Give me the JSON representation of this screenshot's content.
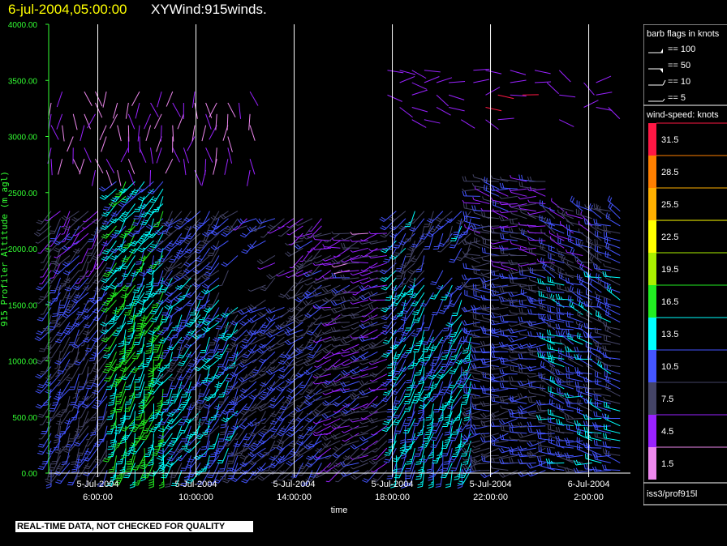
{
  "header": {
    "timestamp": "6-jul-2004,05:00:00",
    "variable": "XYWind:915winds."
  },
  "colors": {
    "title": "#ffff00",
    "y_axis": "#33ff33",
    "frame": "#ffffff"
  },
  "legend": {
    "barb_title": "barb flags in knots",
    "barbs": [
      {
        "label": "== 100"
      },
      {
        "label": "== 50"
      },
      {
        "label": "== 10"
      },
      {
        "label": "== 5"
      }
    ],
    "speed_title": "wind-speed: knots",
    "speed_bins": [
      {
        "label": "31.5",
        "color": "#ff1744"
      },
      {
        "label": "28.5",
        "color": "#ff7f00"
      },
      {
        "label": "25.5",
        "color": "#ffb000"
      },
      {
        "label": "22.5",
        "color": "#ffff00"
      },
      {
        "label": "19.5",
        "color": "#aaf000"
      },
      {
        "label": "16.5",
        "color": "#22ee22"
      },
      {
        "label": "13.5",
        "color": "#00ffff"
      },
      {
        "label": "10.5",
        "color": "#4455ff"
      },
      {
        "label": "7.5",
        "color": "#444466"
      },
      {
        "label": "4.5",
        "color": "#9922ff"
      },
      {
        "label": "1.5",
        "color": "#ee88ee"
      }
    ],
    "source": "iss3/prof915l"
  },
  "disclaimer": "REAL-TIME DATA, NOT CHECKED FOR QUALITY",
  "chart_data": {
    "type": "scatter",
    "subtype": "wind-barb time-height",
    "ylabel": "915 Profiler Altitude (m agl)",
    "xlabel": "time",
    "ylim": [
      0,
      4000
    ],
    "y_ticks": [
      "0.00",
      "500.00",
      "1000.00",
      "1500.00",
      "2000.00",
      "2500.00",
      "3000.00",
      "3500.00",
      "4000.00"
    ],
    "xlim_hours": [
      4.0,
      27.7
    ],
    "x_ticks": [
      {
        "hours": 6,
        "date": "5-Jul-2004",
        "time": "6:00:00"
      },
      {
        "hours": 10,
        "date": "5-Jul-2004",
        "time": "10:00:00"
      },
      {
        "hours": 14,
        "date": "5-Jul-2004",
        "time": "14:00:00"
      },
      {
        "hours": 18,
        "date": "5-Jul-2004",
        "time": "18:00:00"
      },
      {
        "hours": 22,
        "date": "5-Jul-2004",
        "time": "22:00:00"
      },
      {
        "hours": 26,
        "date": "6-Jul-2004",
        "time": "2:00:00"
      }
    ],
    "grid": "vertical at x ticks",
    "wind_regimes": [
      {
        "t_start": 4.0,
        "t_end": 6.5,
        "z_top": 2400,
        "dir_deg": 200,
        "speed_kt": 9
      },
      {
        "t_start": 6.5,
        "t_end": 9.0,
        "z_top": 2600,
        "dir_deg": 195,
        "speed_kt": 15
      },
      {
        "t_start": 9.0,
        "t_end": 12.0,
        "z_top": 2400,
        "dir_deg": 205,
        "speed_kt": 11
      },
      {
        "t_start": 12.0,
        "t_end": 15.5,
        "z_top": 2300,
        "dir_deg": 220,
        "speed_kt": 9
      },
      {
        "t_start": 15.5,
        "t_end": 18.0,
        "z_top": 2200,
        "dir_deg": 240,
        "speed_kt": 7
      },
      {
        "t_start": 18.0,
        "t_end": 21.5,
        "z_top": 2400,
        "dir_deg": 195,
        "speed_kt": 12
      },
      {
        "t_start": 21.5,
        "t_end": 24.5,
        "z_top": 2600,
        "dir_deg": 260,
        "speed_kt": 9
      },
      {
        "t_start": 24.5,
        "t_end": 27.7,
        "z_top": 2400,
        "dir_deg": 280,
        "speed_kt": 10
      }
    ]
  }
}
